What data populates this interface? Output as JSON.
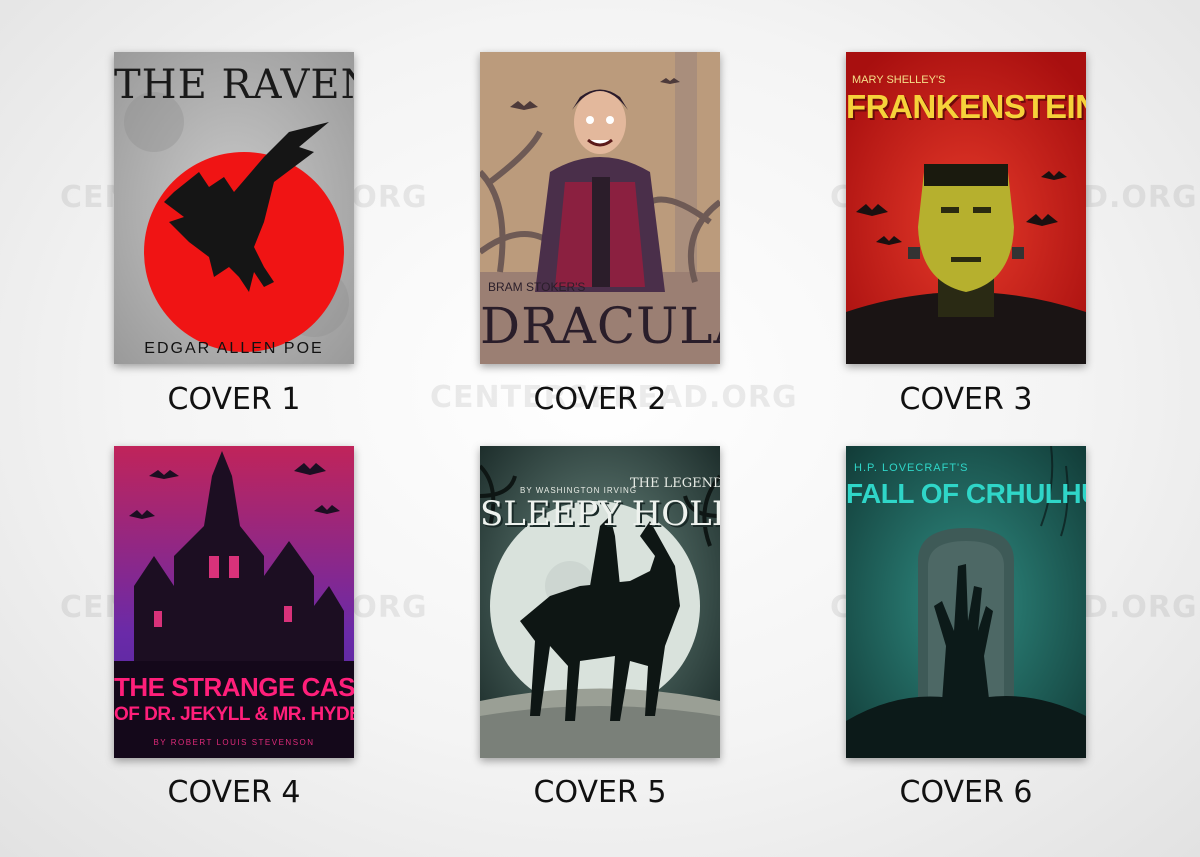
{
  "watermark": "CENTERSPREAD.ORG",
  "covers": [
    {
      "label": "COVER 1",
      "title": "THE RAVEN",
      "author": "EDGAR ALLEN POE"
    },
    {
      "label": "COVER 2",
      "title": "DRACULA",
      "author": "BRAM STOKER'S"
    },
    {
      "label": "COVER 3",
      "title": "FRANKENSTEIN",
      "author": "MARY SHELLEY'S"
    },
    {
      "label": "COVER 4",
      "title_line1": "THE STRANGE CASE",
      "title_line2": "OF DR. JEKYLL & MR. HYDE",
      "author": "BY ROBERT LOUIS STEVENSON"
    },
    {
      "label": "COVER 5",
      "title_line1": "THE LEGEND OF",
      "title_line2": "SLEEPY HOLLOW",
      "author": "BY WASHINGTON IRVING"
    },
    {
      "label": "COVER 6",
      "title": "FALL OF CRHULHU",
      "author": "H.P. LOVECRAFT'S"
    }
  ],
  "colors": {
    "raven_moon": "#f01414",
    "frankenstein_bg": "#d41f1f",
    "jekyll_title": "#ff1f7a",
    "cthulhu_title": "#2fd6c8",
    "cthulhu_bg": "#1f6e66"
  }
}
